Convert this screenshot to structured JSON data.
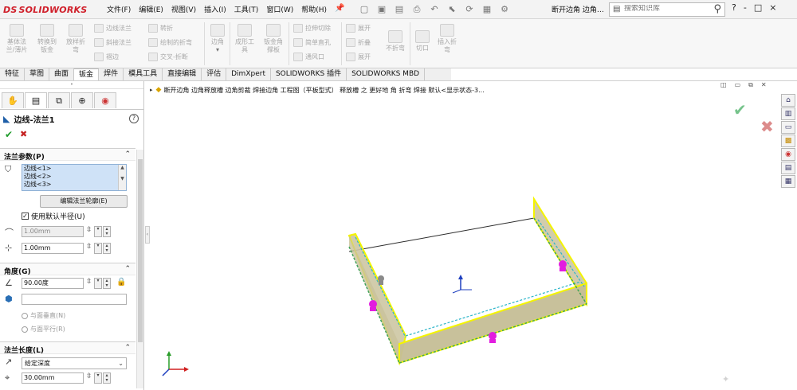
{
  "app": {
    "logo_mark": "DS",
    "logo_text": "SOLIDWORKS",
    "menus": [
      "文件(F)",
      "编辑(E)",
      "视图(V)",
      "插入(I)",
      "工具(T)",
      "窗口(W)",
      "帮助(H)"
    ],
    "doc_title": "断开边角 边角…",
    "search_placeholder": "搜索知识库",
    "window_controls": [
      "?",
      "-",
      "□",
      "×"
    ]
  },
  "ribbon": {
    "big_buttons": [
      {
        "id": "base-flange",
        "label": "基体法\n兰/薄片"
      },
      {
        "id": "convert-sheet",
        "label": "转换到\n钣金"
      },
      {
        "id": "lofted-bend",
        "label": "放样折\n弯"
      },
      {
        "id": "corners",
        "label": "边角"
      },
      {
        "id": "forming-tool",
        "label": "成形工\n具"
      },
      {
        "id": "sheet-gusset",
        "label": "钣金角\n撑板"
      },
      {
        "id": "no-bends",
        "label": "不折弯"
      },
      {
        "id": "cut-off",
        "label": "切口"
      },
      {
        "id": "insert-bends",
        "label": "插入折\n弯"
      }
    ],
    "small_buttons": [
      {
        "id": "edge-flange",
        "label": "边线法兰"
      },
      {
        "id": "miter-flange",
        "label": "斜接法兰"
      },
      {
        "id": "hem",
        "label": "褶边"
      },
      {
        "id": "jog",
        "label": "转折"
      },
      {
        "id": "sketched-bend",
        "label": "绘制的折弯"
      },
      {
        "id": "cross-break",
        "label": "交叉-折断"
      },
      {
        "id": "extruded-cut",
        "label": "拉伸切除"
      },
      {
        "id": "simple-hole",
        "label": "简单直孔"
      },
      {
        "id": "vent",
        "label": "通风口"
      },
      {
        "id": "unfold",
        "label": "展开"
      },
      {
        "id": "fold",
        "label": "折叠"
      },
      {
        "id": "flatten",
        "label": "展开"
      }
    ]
  },
  "tabs": [
    {
      "label": "特征",
      "active": false
    },
    {
      "label": "草图",
      "active": false
    },
    {
      "label": "曲面",
      "active": false
    },
    {
      "label": "钣金",
      "active": true
    },
    {
      "label": "焊件",
      "active": false
    },
    {
      "label": "模具工具",
      "active": false
    },
    {
      "label": "直接编辑",
      "active": false
    },
    {
      "label": "评估",
      "active": false
    },
    {
      "label": "DimXpert",
      "active": false
    },
    {
      "label": "SOLIDWORKS 插件",
      "active": false
    },
    {
      "label": "SOLIDWORKS MBD",
      "active": false
    }
  ],
  "property_manager": {
    "title": "边线-法兰1",
    "sections": {
      "flange_params": "法兰参数(P)",
      "angle": "角度(G)",
      "flange_length": "法兰长度(L)"
    },
    "edges": [
      "边线<1>",
      "边线<2>",
      "边线<3>"
    ],
    "edit_profile_label": "编辑法兰轮廓(E)",
    "use_default_radius_label": "使用默认半径(U)",
    "use_default_radius": true,
    "radius_value": "1.00mm",
    "gap_value": "1.00mm",
    "angle_value": "90.00度",
    "face_value": "",
    "perp_face_label": "与面垂直(N)",
    "parallel_face_label": "与面平行(R)",
    "length_condition": "给定深度",
    "length_value": "30.00mm"
  },
  "viewport": {
    "breadcrumb": "断开边角 边角释放槽 边角剪裁 焊接边角 工程图（平板型式） 释放槽 之 更好地 角 折弯 焊接 默认<显示状态-3...",
    "vp_controls": [
      "◫",
      "▭",
      "⧉",
      "✕"
    ]
  },
  "taskpane": [
    "home-icon",
    "resources-icon",
    "library-icon",
    "explorer-icon",
    "appearance-icon",
    "properties-icon",
    "forum-icon"
  ],
  "colors": {
    "brand": "#d01f2a",
    "edge_highlight": "#f4f400",
    "flange_fill": "#cdc7a3",
    "base_fill": "#ffffff",
    "handle": "#e21de0"
  }
}
